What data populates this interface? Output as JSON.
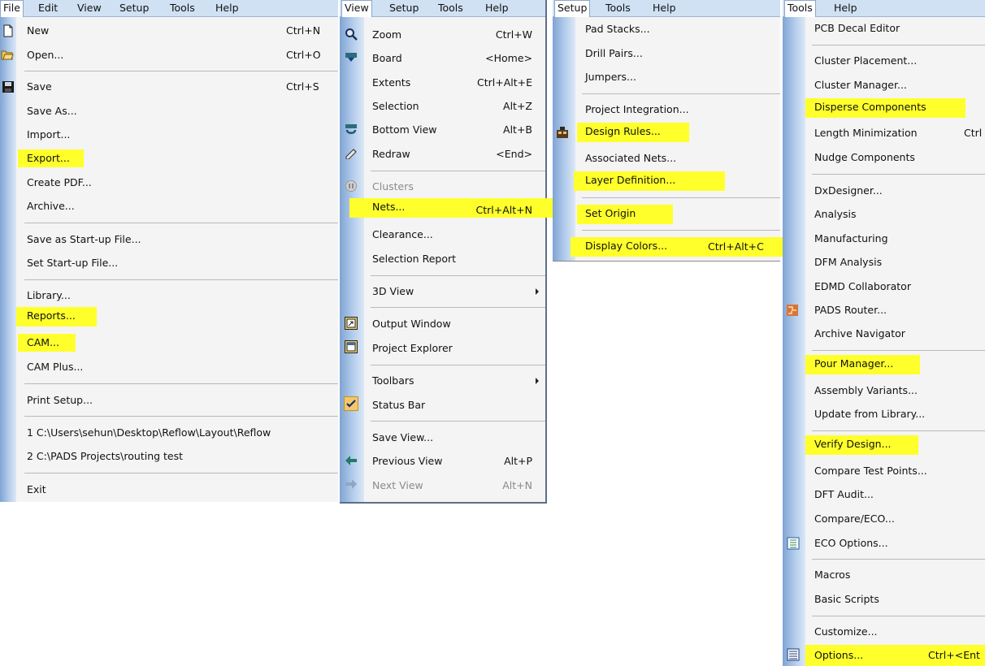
{
  "file_panel": {
    "menubar": [
      "File",
      "Edit",
      "View",
      "Setup",
      "Tools",
      "Help"
    ],
    "items": [
      {
        "label": "New",
        "shortcut": "Ctrl+N"
      },
      {
        "label": "Open...",
        "shortcut": "Ctrl+O"
      },
      {
        "label": "Save",
        "shortcut": "Ctrl+S"
      },
      {
        "label": "Save As...",
        "shortcut": ""
      },
      {
        "label": "Import...",
        "shortcut": ""
      },
      {
        "label": "Export...",
        "shortcut": ""
      },
      {
        "label": "Create PDF...",
        "shortcut": ""
      },
      {
        "label": "Archive...",
        "shortcut": ""
      },
      {
        "label": "Save as Start-up File...",
        "shortcut": ""
      },
      {
        "label": "Set Start-up File...",
        "shortcut": ""
      },
      {
        "label": "Library...",
        "shortcut": ""
      },
      {
        "label": "Reports...",
        "shortcut": ""
      },
      {
        "label": "CAM...",
        "shortcut": ""
      },
      {
        "label": "CAM Plus...",
        "shortcut": ""
      },
      {
        "label": "Print Setup...",
        "shortcut": ""
      },
      {
        "label": "1 C:\\Users\\sehun\\Desktop\\Reflow\\Layout\\Reflow",
        "shortcut": ""
      },
      {
        "label": "2 C:\\PADS Projects\\routing test",
        "shortcut": ""
      },
      {
        "label": "Exit",
        "shortcut": ""
      }
    ]
  },
  "view_panel": {
    "menubar": [
      "View",
      "Setup",
      "Tools",
      "Help"
    ],
    "items": [
      {
        "label": "Zoom",
        "shortcut": "Ctrl+W"
      },
      {
        "label": "Board",
        "shortcut": "<Home>"
      },
      {
        "label": "Extents",
        "shortcut": "Ctrl+Alt+E"
      },
      {
        "label": "Selection",
        "shortcut": "Alt+Z"
      },
      {
        "label": "Bottom View",
        "shortcut": "Alt+B"
      },
      {
        "label": "Redraw",
        "shortcut": "<End>"
      },
      {
        "label": "Clusters",
        "shortcut": ""
      },
      {
        "label": "Nets...",
        "shortcut": "Ctrl+Alt+N"
      },
      {
        "label": "Clearance...",
        "shortcut": ""
      },
      {
        "label": "Selection Report",
        "shortcut": ""
      },
      {
        "label": "3D View",
        "shortcut": ""
      },
      {
        "label": "Output Window",
        "shortcut": ""
      },
      {
        "label": "Project Explorer",
        "shortcut": ""
      },
      {
        "label": "Toolbars",
        "shortcut": ""
      },
      {
        "label": "Status Bar",
        "shortcut": ""
      },
      {
        "label": "Save View...",
        "shortcut": ""
      },
      {
        "label": "Previous View",
        "shortcut": "Alt+P"
      },
      {
        "label": "Next View",
        "shortcut": "Alt+N"
      }
    ]
  },
  "setup_panel": {
    "menubar": [
      "Setup",
      "Tools",
      "Help"
    ],
    "items": [
      {
        "label": "Pad Stacks...",
        "shortcut": ""
      },
      {
        "label": "Drill Pairs...",
        "shortcut": ""
      },
      {
        "label": "Jumpers...",
        "shortcut": ""
      },
      {
        "label": "Project Integration...",
        "shortcut": ""
      },
      {
        "label": "Design Rules...",
        "shortcut": ""
      },
      {
        "label": "Associated Nets...",
        "shortcut": ""
      },
      {
        "label": "Layer Definition...",
        "shortcut": ""
      },
      {
        "label": "Set Origin",
        "shortcut": ""
      },
      {
        "label": "Display Colors...",
        "shortcut": "Ctrl+Alt+C"
      }
    ]
  },
  "tools_panel": {
    "menubar": [
      "Tools",
      "Help"
    ],
    "items": [
      {
        "label": "PCB Decal Editor",
        "shortcut": ""
      },
      {
        "label": "Cluster Placement...",
        "shortcut": ""
      },
      {
        "label": "Cluster Manager...",
        "shortcut": ""
      },
      {
        "label": "Disperse Components",
        "shortcut": ""
      },
      {
        "label": "Length Minimization",
        "shortcut": "Ctrl"
      },
      {
        "label": "Nudge Components",
        "shortcut": ""
      },
      {
        "label": "DxDesigner...",
        "shortcut": ""
      },
      {
        "label": "Analysis",
        "shortcut": ""
      },
      {
        "label": "Manufacturing",
        "shortcut": ""
      },
      {
        "label": "DFM Analysis",
        "shortcut": ""
      },
      {
        "label": "EDMD Collaborator",
        "shortcut": ""
      },
      {
        "label": "PADS Router...",
        "shortcut": ""
      },
      {
        "label": "Archive Navigator",
        "shortcut": ""
      },
      {
        "label": "Pour Manager...",
        "shortcut": ""
      },
      {
        "label": "Assembly Variants...",
        "shortcut": ""
      },
      {
        "label": "Update from Library...",
        "shortcut": ""
      },
      {
        "label": "Verify Design...",
        "shortcut": ""
      },
      {
        "label": "Compare Test Points...",
        "shortcut": ""
      },
      {
        "label": "DFT Audit...",
        "shortcut": ""
      },
      {
        "label": "Compare/ECO...",
        "shortcut": ""
      },
      {
        "label": "ECO Options...",
        "shortcut": ""
      },
      {
        "label": "Macros",
        "shortcut": ""
      },
      {
        "label": "Basic Scripts",
        "shortcut": ""
      },
      {
        "label": "Customize...",
        "shortcut": ""
      },
      {
        "label": "Options...",
        "shortcut": "Ctrl+<Ent"
      }
    ]
  },
  "colors": {
    "highlight": "#ffff2b",
    "menubar": "#cfe1f3",
    "gutter": "#7fa4d3",
    "menu_bg": "#f4f4f4"
  }
}
